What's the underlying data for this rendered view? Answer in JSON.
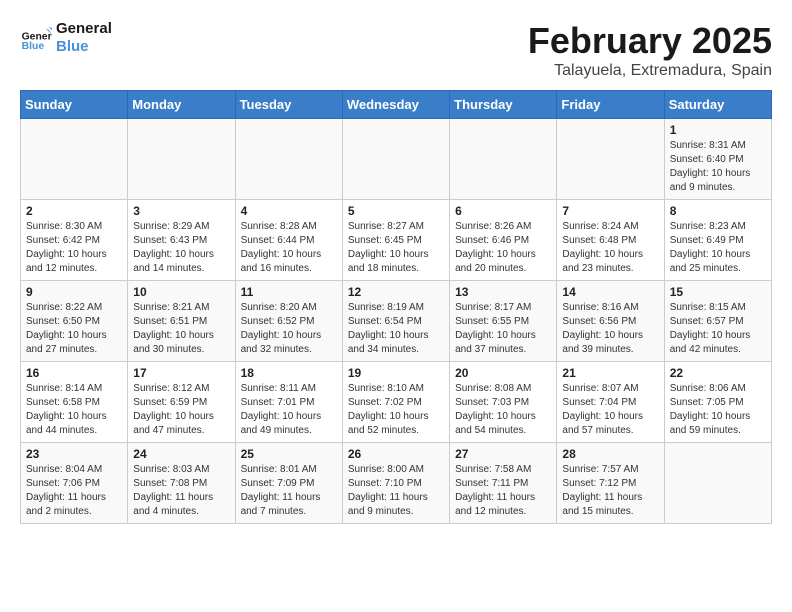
{
  "logo": {
    "line1": "General",
    "line2": "Blue"
  },
  "title": "February 2025",
  "subtitle": "Talayuela, Extremadura, Spain",
  "weekdays": [
    "Sunday",
    "Monday",
    "Tuesday",
    "Wednesday",
    "Thursday",
    "Friday",
    "Saturday"
  ],
  "weeks": [
    [
      {
        "day": "",
        "info": ""
      },
      {
        "day": "",
        "info": ""
      },
      {
        "day": "",
        "info": ""
      },
      {
        "day": "",
        "info": ""
      },
      {
        "day": "",
        "info": ""
      },
      {
        "day": "",
        "info": ""
      },
      {
        "day": "1",
        "info": "Sunrise: 8:31 AM\nSunset: 6:40 PM\nDaylight: 10 hours\nand 9 minutes."
      }
    ],
    [
      {
        "day": "2",
        "info": "Sunrise: 8:30 AM\nSunset: 6:42 PM\nDaylight: 10 hours\nand 12 minutes."
      },
      {
        "day": "3",
        "info": "Sunrise: 8:29 AM\nSunset: 6:43 PM\nDaylight: 10 hours\nand 14 minutes."
      },
      {
        "day": "4",
        "info": "Sunrise: 8:28 AM\nSunset: 6:44 PM\nDaylight: 10 hours\nand 16 minutes."
      },
      {
        "day": "5",
        "info": "Sunrise: 8:27 AM\nSunset: 6:45 PM\nDaylight: 10 hours\nand 18 minutes."
      },
      {
        "day": "6",
        "info": "Sunrise: 8:26 AM\nSunset: 6:46 PM\nDaylight: 10 hours\nand 20 minutes."
      },
      {
        "day": "7",
        "info": "Sunrise: 8:24 AM\nSunset: 6:48 PM\nDaylight: 10 hours\nand 23 minutes."
      },
      {
        "day": "8",
        "info": "Sunrise: 8:23 AM\nSunset: 6:49 PM\nDaylight: 10 hours\nand 25 minutes."
      }
    ],
    [
      {
        "day": "9",
        "info": "Sunrise: 8:22 AM\nSunset: 6:50 PM\nDaylight: 10 hours\nand 27 minutes."
      },
      {
        "day": "10",
        "info": "Sunrise: 8:21 AM\nSunset: 6:51 PM\nDaylight: 10 hours\nand 30 minutes."
      },
      {
        "day": "11",
        "info": "Sunrise: 8:20 AM\nSunset: 6:52 PM\nDaylight: 10 hours\nand 32 minutes."
      },
      {
        "day": "12",
        "info": "Sunrise: 8:19 AM\nSunset: 6:54 PM\nDaylight: 10 hours\nand 34 minutes."
      },
      {
        "day": "13",
        "info": "Sunrise: 8:17 AM\nSunset: 6:55 PM\nDaylight: 10 hours\nand 37 minutes."
      },
      {
        "day": "14",
        "info": "Sunrise: 8:16 AM\nSunset: 6:56 PM\nDaylight: 10 hours\nand 39 minutes."
      },
      {
        "day": "15",
        "info": "Sunrise: 8:15 AM\nSunset: 6:57 PM\nDaylight: 10 hours\nand 42 minutes."
      }
    ],
    [
      {
        "day": "16",
        "info": "Sunrise: 8:14 AM\nSunset: 6:58 PM\nDaylight: 10 hours\nand 44 minutes."
      },
      {
        "day": "17",
        "info": "Sunrise: 8:12 AM\nSunset: 6:59 PM\nDaylight: 10 hours\nand 47 minutes."
      },
      {
        "day": "18",
        "info": "Sunrise: 8:11 AM\nSunset: 7:01 PM\nDaylight: 10 hours\nand 49 minutes."
      },
      {
        "day": "19",
        "info": "Sunrise: 8:10 AM\nSunset: 7:02 PM\nDaylight: 10 hours\nand 52 minutes."
      },
      {
        "day": "20",
        "info": "Sunrise: 8:08 AM\nSunset: 7:03 PM\nDaylight: 10 hours\nand 54 minutes."
      },
      {
        "day": "21",
        "info": "Sunrise: 8:07 AM\nSunset: 7:04 PM\nDaylight: 10 hours\nand 57 minutes."
      },
      {
        "day": "22",
        "info": "Sunrise: 8:06 AM\nSunset: 7:05 PM\nDaylight: 10 hours\nand 59 minutes."
      }
    ],
    [
      {
        "day": "23",
        "info": "Sunrise: 8:04 AM\nSunset: 7:06 PM\nDaylight: 11 hours\nand 2 minutes."
      },
      {
        "day": "24",
        "info": "Sunrise: 8:03 AM\nSunset: 7:08 PM\nDaylight: 11 hours\nand 4 minutes."
      },
      {
        "day": "25",
        "info": "Sunrise: 8:01 AM\nSunset: 7:09 PM\nDaylight: 11 hours\nand 7 minutes."
      },
      {
        "day": "26",
        "info": "Sunrise: 8:00 AM\nSunset: 7:10 PM\nDaylight: 11 hours\nand 9 minutes."
      },
      {
        "day": "27",
        "info": "Sunrise: 7:58 AM\nSunset: 7:11 PM\nDaylight: 11 hours\nand 12 minutes."
      },
      {
        "day": "28",
        "info": "Sunrise: 7:57 AM\nSunset: 7:12 PM\nDaylight: 11 hours\nand 15 minutes."
      },
      {
        "day": "",
        "info": ""
      }
    ]
  ]
}
